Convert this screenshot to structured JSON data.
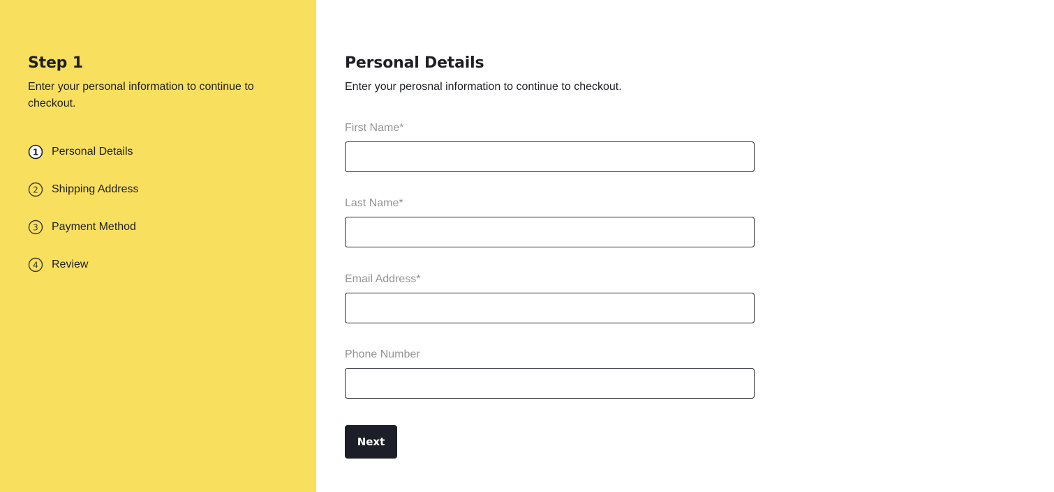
{
  "sidebar": {
    "title": "Step 1",
    "description": "Enter your personal information to continue to checkout.",
    "steps": [
      {
        "number": "1",
        "label": "Personal Details",
        "active": true
      },
      {
        "number": "2",
        "label": "Shipping Address",
        "active": false
      },
      {
        "number": "3",
        "label": "Payment Method",
        "active": false
      },
      {
        "number": "4",
        "label": "Review",
        "active": false
      }
    ]
  },
  "main": {
    "title": "Personal Details",
    "description": "Enter your perosnal information to continue to checkout.",
    "fields": [
      {
        "label": "First Name*",
        "value": ""
      },
      {
        "label": "Last Name*",
        "value": ""
      },
      {
        "label": "Email Address*",
        "value": ""
      },
      {
        "label": "Phone Number",
        "value": ""
      }
    ],
    "next_label": "Next"
  },
  "colors": {
    "sidebar_bg": "#f9df5e",
    "button_bg": "#1d1f28",
    "label_color": "#939393"
  }
}
